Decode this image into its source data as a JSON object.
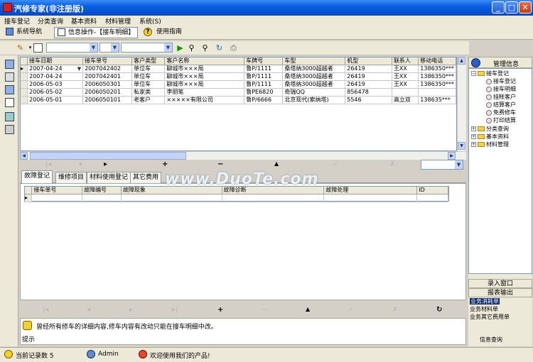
{
  "window": {
    "title": "汽修专家(非注册版)",
    "min": "_",
    "max": "□",
    "close": "✕"
  },
  "menu": [
    "接车登记",
    "分类查询",
    "基本资料",
    "材料管理",
    "系统(S)"
  ],
  "nav": {
    "tab1": "系统导航",
    "tab2": "信息操作-【接车明细】",
    "tab3": "使用指南"
  },
  "grid1": {
    "columns": [
      "接车日期",
      "接车单号",
      "客户类型",
      "客户名称",
      "车牌号",
      "车型",
      "机型",
      "联系人",
      "移动电话"
    ],
    "rows": [
      [
        "2007-04-24",
        "2007042402",
        "单位车",
        "聊城市×××局",
        "鲁P/1111",
        "桑塔纳3000超越者",
        "26419",
        "王XX",
        "1386350***"
      ],
      [
        "2007-04-24",
        "2007042401",
        "单位车",
        "聊城市×××局",
        "鲁P/1111",
        "桑塔纳3000超越者",
        "26419",
        "王XX",
        "1386350***"
      ],
      [
        "2006-05-03",
        "2006050301",
        "单位车",
        "聊城市×××局",
        "鲁P/1111",
        "桑塔纳3000超越者",
        "26419",
        "王XX",
        "1386350***"
      ],
      [
        "2006-05-02",
        "2006050201",
        "私家类",
        "李朋笔",
        "鲁PE6820",
        "奇瑞QQ",
        "856478",
        "",
        ""
      ],
      [
        "2006-05-01",
        "2006050101",
        "老客户",
        "×××××有限公司",
        "鲁P/6666",
        "北京现代(索纳塔)",
        "5546",
        "高立双",
        "138635***"
      ]
    ]
  },
  "navigator": {
    "first": "|◂",
    "prior": "◂",
    "next": "▸",
    "last": "▸|",
    "insert": "+",
    "delete": "−",
    "edit": "▲",
    "post": "✓",
    "cancel": "✗",
    "refresh": "↻"
  },
  "subtabs": [
    "故障登记",
    "维修项目",
    "材料使用登记",
    "其它费用"
  ],
  "grid2": {
    "columns": [
      "接车单号",
      "故障编号",
      "故障现象",
      "故障诊断",
      "故障处理",
      "ID"
    ]
  },
  "hint": {
    "label": "提示",
    "text": "曾经所有修车的详细内容,修车内容有改动只能在接车明细中改。"
  },
  "tree": {
    "header": "管理信息",
    "root": "接车登记",
    "children": [
      "接车登记",
      "接车明细",
      "挂帐客户",
      "结算客户",
      "免费修车",
      "打印结算"
    ],
    "others": [
      "分类查询",
      "基本资料",
      "材料管理"
    ]
  },
  "rightbuttons": {
    "entry": "录入窗口",
    "report": "报表输出"
  },
  "rightitems": [
    "业务消耗单",
    "业务材料单",
    "业务其它费用单",
    "信息查询"
  ],
  "status": {
    "records": "当前记录数 5",
    "user": "Admin",
    "welcome": "欢迎使用我们的产品!"
  },
  "watermark": "www.DuoTe.com"
}
